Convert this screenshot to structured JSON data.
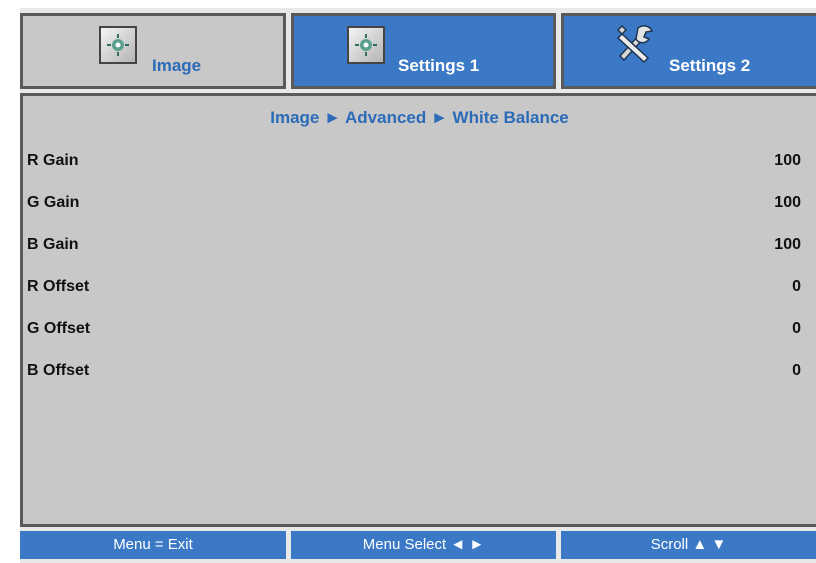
{
  "tabs": [
    {
      "label": "Image",
      "icon": "image-icon",
      "state": "inactive"
    },
    {
      "label": "Settings 1",
      "icon": "settings1-icon",
      "state": "active"
    },
    {
      "label": "Settings 2",
      "icon": "tools-icon",
      "state": "active"
    }
  ],
  "breadcrumb": "Image ► Advanced ► White Balance",
  "settings": [
    {
      "label": "R Gain",
      "value": "100"
    },
    {
      "label": "G Gain",
      "value": "100"
    },
    {
      "label": "B Gain",
      "value": "100"
    },
    {
      "label": "R Offset",
      "value": "0"
    },
    {
      "label": "G Offset",
      "value": "0"
    },
    {
      "label": "B Offset",
      "value": "0"
    }
  ],
  "footer": {
    "exit": "Menu = Exit",
    "select": "Menu Select ◄ ►",
    "scroll": "Scroll ▲ ▼"
  },
  "colors": {
    "accent_blue": "#3b79c6",
    "panel_gray": "#c8c8c8",
    "label_blue": "#2b6bb8"
  }
}
